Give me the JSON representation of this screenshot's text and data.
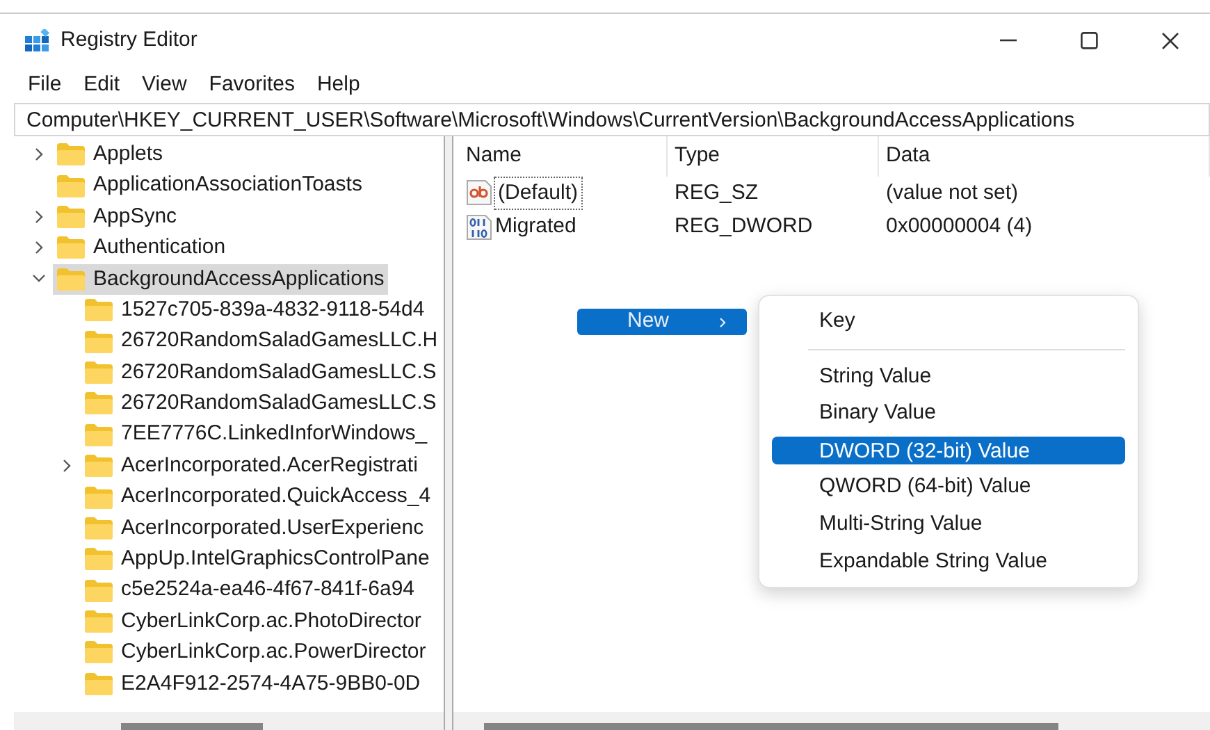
{
  "window": {
    "title": "Registry Editor"
  },
  "menu_bar": [
    "File",
    "Edit",
    "View",
    "Favorites",
    "Help"
  ],
  "address": "Computer\\HKEY_CURRENT_USER\\Software\\Microsoft\\Windows\\CurrentVersion\\BackgroundAccessApplications",
  "tree": [
    {
      "label": "Applets",
      "expanded": false,
      "selected": false
    },
    {
      "label": "ApplicationAssociationToasts",
      "selected": false
    },
    {
      "label": "AppSync",
      "expanded": false,
      "selected": false
    },
    {
      "label": "Authentication",
      "expanded": false,
      "selected": false
    },
    {
      "label": "BackgroundAccessApplications",
      "expanded": true,
      "selected": true,
      "children": [
        {
          "label": "1527c705-839a-4832-9118-54d4",
          "selected": false
        },
        {
          "label": "26720RandomSaladGamesLLC.H",
          "selected": false
        },
        {
          "label": "26720RandomSaladGamesLLC.S",
          "selected": false
        },
        {
          "label": "26720RandomSaladGamesLLC.S",
          "selected": false
        },
        {
          "label": "7EE7776C.LinkedInforWindows_",
          "selected": false
        },
        {
          "label": "AcerIncorporated.AcerRegistrati",
          "expanded": false,
          "selected": false
        },
        {
          "label": "AcerIncorporated.QuickAccess_4",
          "selected": false
        },
        {
          "label": "AcerIncorporated.UserExperienc",
          "selected": false
        },
        {
          "label": "AppUp.IntelGraphicsControlPane",
          "selected": false
        },
        {
          "label": "c5e2524a-ea46-4f67-841f-6a94",
          "selected": false
        },
        {
          "label": "CyberLinkCorp.ac.PhotoDirector",
          "selected": false
        },
        {
          "label": "CyberLinkCorp.ac.PowerDirector",
          "selected": false
        },
        {
          "label": "E2A4F912-2574-4A75-9BB0-0D",
          "selected": false
        }
      ]
    }
  ],
  "values": {
    "columns": [
      "Name",
      "Type",
      "Data"
    ],
    "rows": [
      {
        "kind": "string",
        "name": "(Default)",
        "type": "REG_SZ",
        "data": "(value not set)",
        "focused": true
      },
      {
        "kind": "binary",
        "name": "Migrated",
        "type": "REG_DWORD",
        "data": "0x00000004 (4)",
        "focused": false
      }
    ]
  },
  "context_menu": {
    "items": [
      {
        "label": "New",
        "submenu": true,
        "selected": true
      }
    ]
  },
  "submenu": {
    "items": [
      {
        "label": "Key",
        "selected": false,
        "separator_after": true
      },
      {
        "label": "String Value",
        "selected": false,
        "separator_after": false
      },
      {
        "label": "Binary Value",
        "selected": false,
        "separator_after": false
      },
      {
        "label": "DWORD (32-bit) Value",
        "selected": true,
        "separator_after": false
      },
      {
        "label": "QWORD (64-bit) Value",
        "selected": false,
        "separator_after": false
      },
      {
        "label": "Multi-String Value",
        "selected": false,
        "separator_after": false
      },
      {
        "label": "Expandable String Value",
        "selected": false,
        "separator_after": false
      }
    ]
  }
}
